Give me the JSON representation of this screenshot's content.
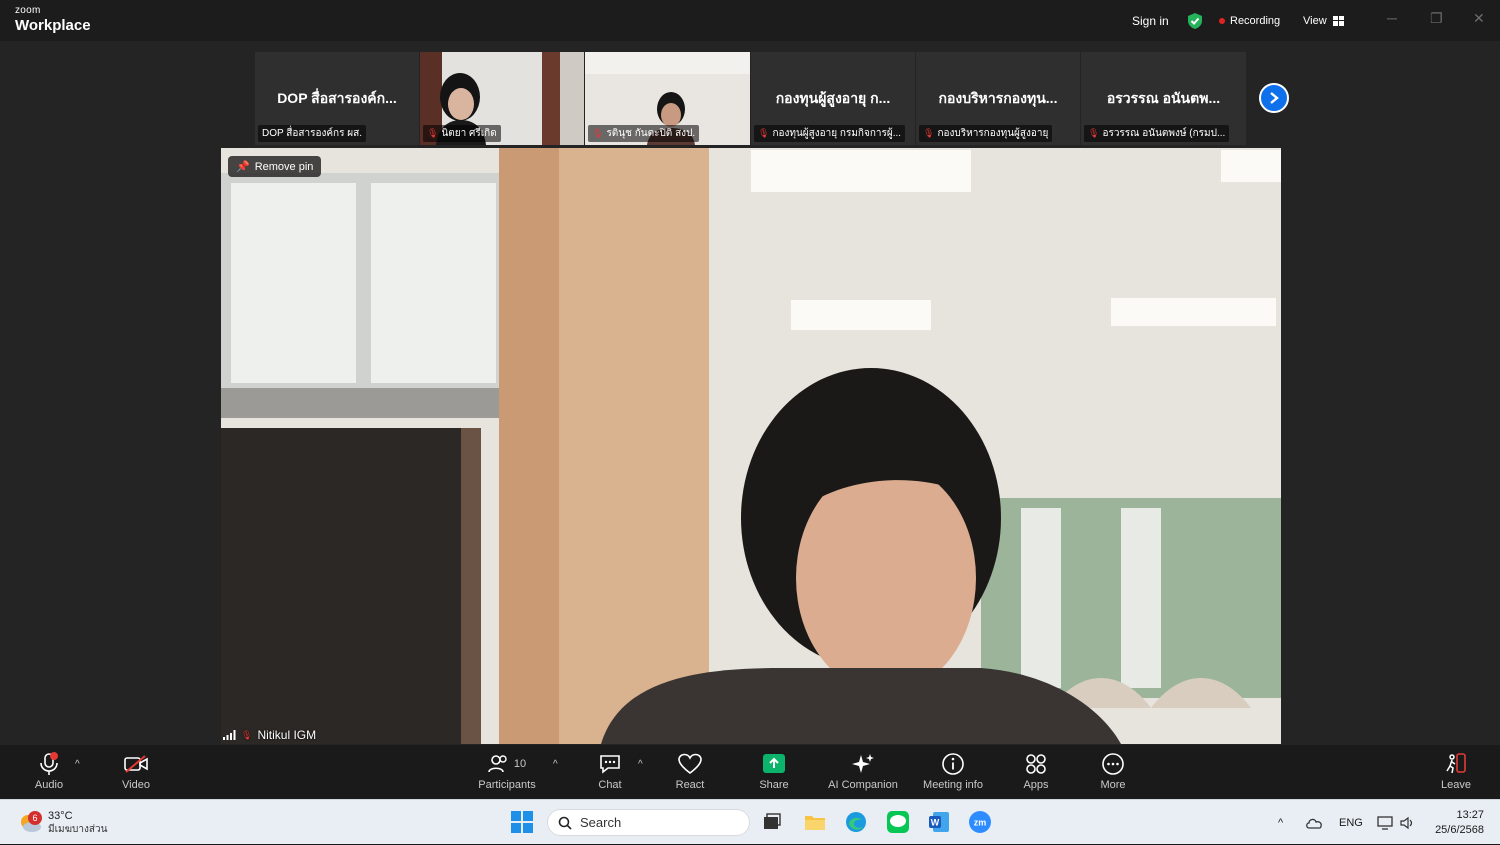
{
  "app": {
    "logo_line1": "zoom",
    "logo_line2": "Workplace"
  },
  "titlebar": {
    "sign_in": "Sign in",
    "recording": "Recording",
    "view": "View"
  },
  "thumbnails": [
    {
      "big": "DOP สื่อสารองค์ก...",
      "name": "DOP สื่อสารองค์กร ผส.",
      "has_mic_off": false
    },
    {
      "big": "",
      "name": "นิตยา ศรีเกิด",
      "has_mic_off": true
    },
    {
      "big": "",
      "name": "รตินุช กันตะปิติ สงป.",
      "has_mic_off": true
    },
    {
      "big": "กองทุนผู้สูงอายุ ก...",
      "name": "กองทุนผู้สูงอายุ กรมกิจการผู้...",
      "has_mic_off": true
    },
    {
      "big": "กองบริหารกองทุน...",
      "name": "กองบริหารกองทุนผู้สูงอายุ",
      "has_mic_off": true
    },
    {
      "big": "อรวรรณ อนันตพ...",
      "name": "อรวรรณ อนันตพงษ์ (กรมป...",
      "has_mic_off": true
    }
  ],
  "main_video": {
    "remove_pin": "Remove pin",
    "speaker_name": "Nitikul IGM"
  },
  "toolbar": {
    "audio": "Audio",
    "video": "Video",
    "participants": "Participants",
    "participants_count": "10",
    "chat": "Chat",
    "react": "React",
    "share": "Share",
    "ai_companion": "AI Companion",
    "meeting_info": "Meeting info",
    "apps": "Apps",
    "more": "More",
    "leave": "Leave"
  },
  "taskbar": {
    "weather_badge": "6",
    "temperature": "33°C",
    "weather_desc": "มีเมฆบางส่วน",
    "search": "Search",
    "lang": "ENG",
    "time": "13:27",
    "date": "25/6/2568"
  },
  "colors": {
    "accent_blue": "#0e71eb",
    "share_green": "#0bb36b",
    "record_red": "#e02424"
  }
}
